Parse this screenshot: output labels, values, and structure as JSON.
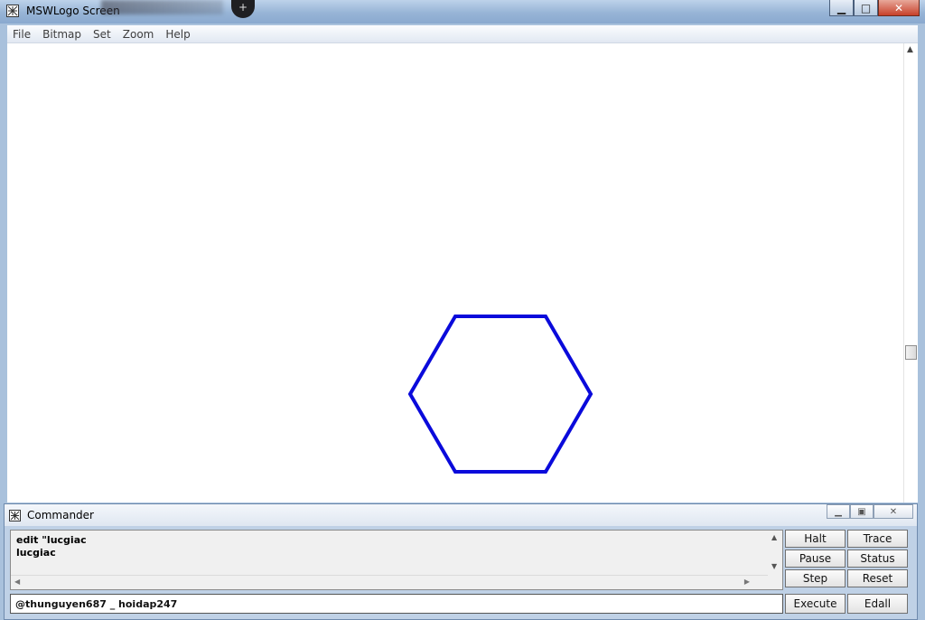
{
  "window": {
    "title": "MSWLogo Screen",
    "blurred_tab_icon": "+",
    "controls": {
      "minimize": "▁",
      "maximize": "□",
      "close": "✕"
    }
  },
  "menu": {
    "items": [
      "File",
      "Bitmap",
      "Set",
      "Zoom",
      "Help"
    ]
  },
  "canvas": {
    "background": "#ffffff",
    "shape": {
      "type": "hexagon",
      "stroke": "#0a0adb"
    }
  },
  "commander": {
    "title": "Commander",
    "controls": {
      "minimize": "▁",
      "restore": "▣",
      "close": "✕"
    },
    "history": [
      "edit \"lucgiac",
      "lucgiac"
    ],
    "input_value": "@thunguyen687 _ hoidap247",
    "buttons": {
      "halt": "Halt",
      "trace": "Trace",
      "pause": "Pause",
      "status": "Status",
      "step": "Step",
      "reset": "Reset",
      "execute": "Execute",
      "edall": "Edall"
    }
  }
}
